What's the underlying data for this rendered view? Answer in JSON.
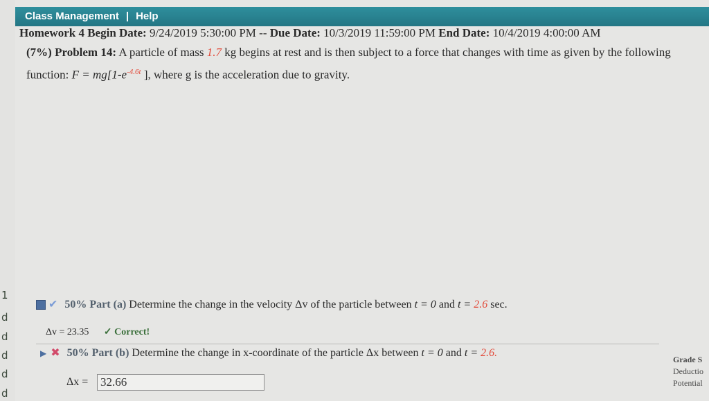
{
  "left_strip": {
    "marks": [
      "1",
      "d",
      "d",
      "d",
      "d",
      "d"
    ]
  },
  "nav": {
    "class_management": "Class Management",
    "separator": "|",
    "help": "Help"
  },
  "homework": {
    "name": "Homework 4",
    "begin_label": "Begin Date:",
    "begin_value": "9/24/2019 5:30:00 PM",
    "dash": "--",
    "due_label": "Due Date:",
    "due_value": "10/3/2019 11:59:00 PM",
    "end_label": "End Date:",
    "end_value": "10/4/2019 4:00:00 AM"
  },
  "problem": {
    "weight": "(7%)",
    "title": "Problem 14:",
    "text1": "A particle of mass",
    "mass": "1.7",
    "text2": "kg begins at rest and is then subject to a force that changes with time as given by the following function:",
    "formula_pre": "F = mg[1-e",
    "exponent": "-4.6t",
    "formula_post": "],",
    "text3": "where g is the acceleration due to gravity."
  },
  "part_a": {
    "percent": "50%",
    "label": "Part (a)",
    "question_pre": "Determine the change in the velocity Δv of the particle between",
    "t_start": "t = 0",
    "and": "and",
    "t_eq": "t =",
    "t_end": "2.6",
    "unit": "sec.",
    "answer_label": "Δv = ",
    "answer_value": "23.35",
    "status": "✓ Correct!"
  },
  "part_b": {
    "percent": "50%",
    "label": "Part (b)",
    "question_pre": "Determine the change in x-coordinate of the particle Δx between",
    "t_start": "t = 0",
    "and": "and",
    "t_eq": "t =",
    "t_end": "2.6.",
    "answer_label": "Δx = ",
    "input_value": "32.66"
  },
  "grade_panel": {
    "line1": "Grade S",
    "line2": "Deductio",
    "line3": "Potential"
  },
  "colors": {
    "header_teal": "#2a8290",
    "accent_red": "#e24b3b",
    "correct_green": "#3a6f3a"
  }
}
